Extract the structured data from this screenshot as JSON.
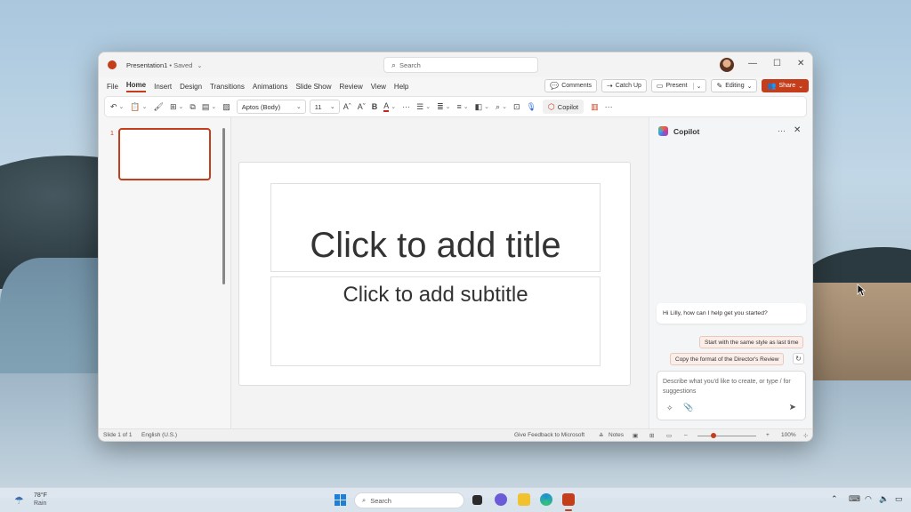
{
  "window": {
    "doc_name": "Presentation1",
    "doc_status": "• Saved",
    "search_placeholder": "Search"
  },
  "menu": {
    "tabs": [
      "File",
      "Home",
      "Insert",
      "Design",
      "Transitions",
      "Animations",
      "Slide Show",
      "Review",
      "View",
      "Help"
    ],
    "active_tab": "Home",
    "comments": "Comments",
    "catch_up": "Catch Up",
    "present": "Present",
    "editing": "Editing",
    "share": "Share"
  },
  "ribbon": {
    "font_name": "Aptos (Body)",
    "font_size": "11",
    "copilot_label": "Copilot"
  },
  "slide": {
    "number": "1",
    "title_placeholder": "Click to add title",
    "subtitle_placeholder": "Click to add subtitle"
  },
  "copilot": {
    "heading": "Copilot",
    "greeting": "Hi Lilly, how can I help get you started?",
    "suggestion_1": "Start with the same style as last time",
    "suggestion_2": "Copy the format of the Director's Review",
    "input_placeholder": "Describe what you'd like to create, or type / for suggestions"
  },
  "statusbar": {
    "slide_count": "Slide 1 of 1",
    "language": "English (U.S.)",
    "feedback": "Give Feedback to Microsoft",
    "notes": "Notes",
    "zoom_minus": "–",
    "zoom_plus": "+",
    "zoom_level": "100%"
  },
  "taskbar": {
    "temperature": "78°F",
    "condition": "Rain",
    "search_placeholder": "Search"
  },
  "colors": {
    "accent": "#c43e1c",
    "taskbar_bg": "#e0e8f0"
  }
}
